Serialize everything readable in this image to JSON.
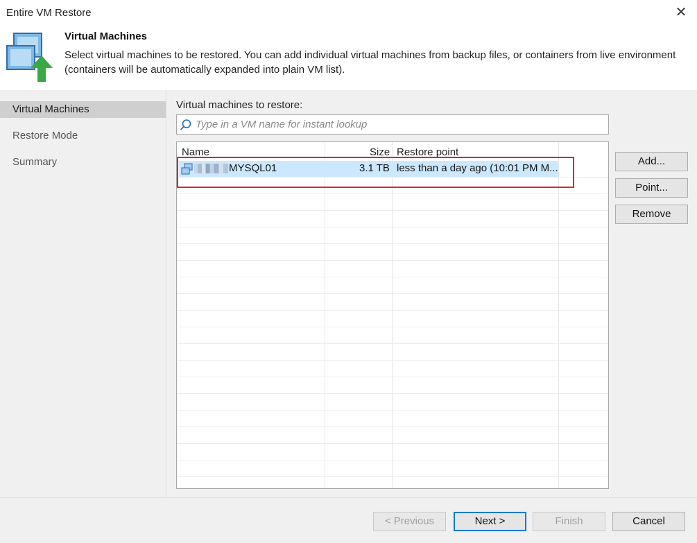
{
  "window": {
    "title": "Entire VM Restore",
    "close_glyph": "✕"
  },
  "header": {
    "title": "Virtual Machines",
    "description": "Select virtual machines to be restored. You can add individual virtual machines from backup files, or containers from live environment (containers will be automatically expanded into plain VM list)."
  },
  "sidebar": {
    "items": [
      {
        "label": "Virtual Machines",
        "active": true
      },
      {
        "label": "Restore Mode",
        "active": false
      },
      {
        "label": "Summary",
        "active": false
      }
    ]
  },
  "main": {
    "list_label": "Virtual machines to restore:",
    "search": {
      "placeholder": "Type in a VM name for instant lookup",
      "value": ""
    },
    "columns": [
      "Name",
      "Size",
      "Restore point"
    ],
    "rows": [
      {
        "name": "MYSQL01",
        "size": "3.1 TB",
        "restore_point": "less than a day ago (10:01 PM M...",
        "selected": true
      }
    ],
    "buttons": {
      "add": "Add...",
      "point": "Point...",
      "remove": "Remove"
    }
  },
  "footer": {
    "previous": "< Previous",
    "next": "Next >",
    "finish": "Finish",
    "cancel": "Cancel"
  },
  "colors": {
    "selection": "#cce8ff",
    "highlight_border": "#d9232e",
    "accent": "#0078d7"
  }
}
